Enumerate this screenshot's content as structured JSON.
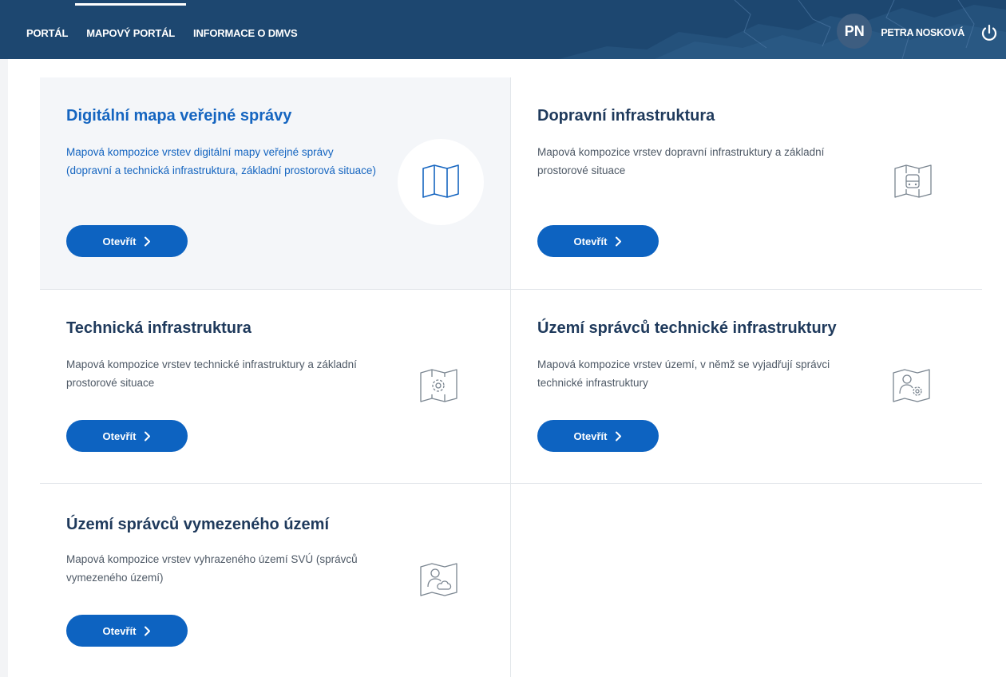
{
  "nav": {
    "items": [
      {
        "label": "PORTÁL",
        "active": false
      },
      {
        "label": "MAPOVÝ PORTÁL",
        "active": true
      },
      {
        "label": "INFORMACE O DMVS",
        "active": false
      }
    ]
  },
  "user": {
    "initials": "PN",
    "name": "PETRA NOSKOVÁ",
    "logout_icon": "power-icon"
  },
  "colors": {
    "header_bg": "#1d4770",
    "primary": "#0d63c1",
    "highlight_card_bg": "#f4f6f9",
    "title": "#1f3a5c",
    "title_active": "#1565c0"
  },
  "cards": [
    {
      "title": "Digitální mapa veřejné správy",
      "description": "Mapová kompozice vrstev digitální mapy veřejné správy (dopravní a technická infrastruktura, základní prostorová situace)",
      "button": "Otevřít",
      "icon": "map-icon",
      "highlighted": true
    },
    {
      "title": "Dopravní infrastruktura",
      "description": "Mapová kompozice vrstev dopravní infrastruktury a základní prostorové situace",
      "button": "Otevřít",
      "icon": "map-car-icon",
      "highlighted": false
    },
    {
      "title": "Technická infrastruktura",
      "description": "Mapová kompozice vrstev technické infrastruktury a základní prostorové situace",
      "button": "Otevřít",
      "icon": "map-gear-icon",
      "highlighted": false
    },
    {
      "title": "Území správců technické infrastruktury",
      "description": "Mapová kompozice vrstev území, v němž se vyjadřují správci technické infrastruktury",
      "button": "Otevřít",
      "icon": "map-person-gear-icon",
      "highlighted": false
    },
    {
      "title": "Území správců vymezeného území",
      "description": "Mapová kompozice vrstev vyhrazeného území SVÚ (správců vymezeného území)",
      "button": "Otevřít",
      "icon": "map-person-area-icon",
      "highlighted": false
    }
  ]
}
